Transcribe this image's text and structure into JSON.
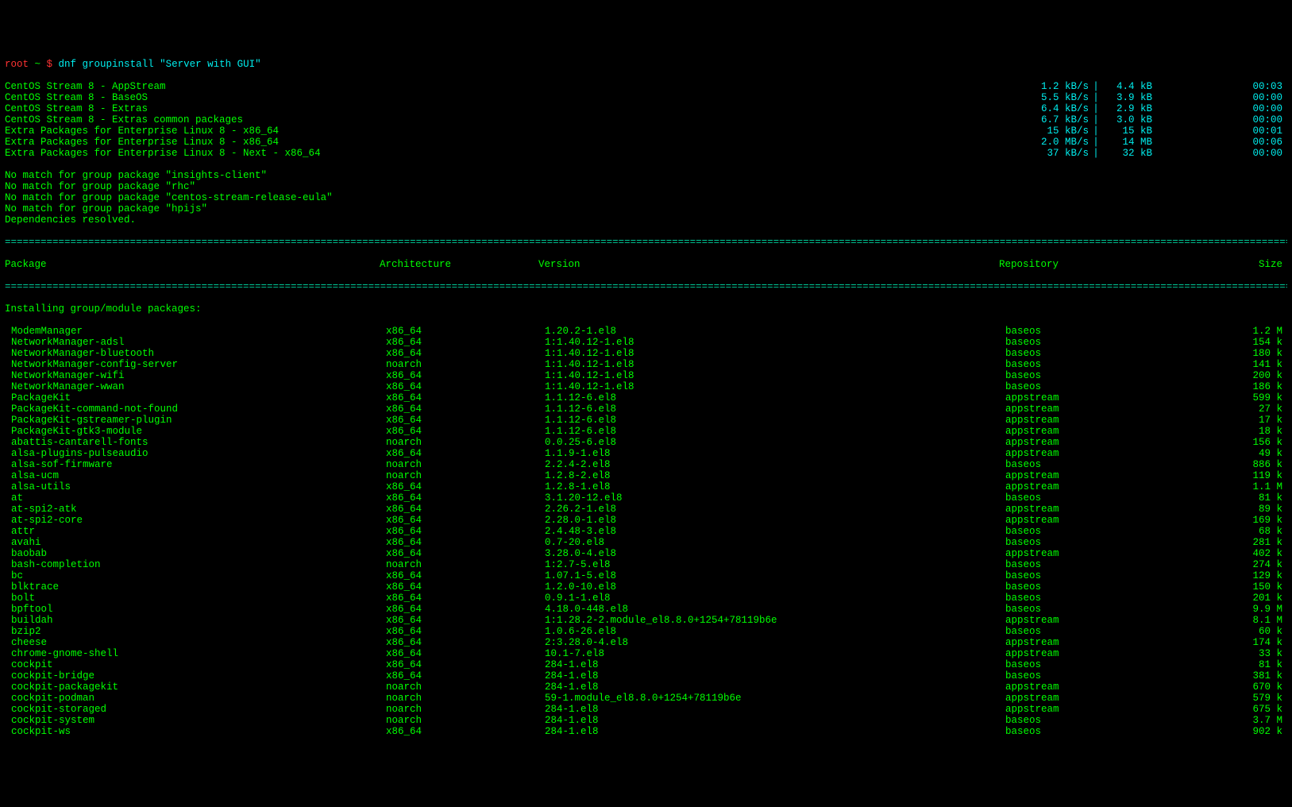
{
  "prompt": {
    "user": "root",
    "sep1": " ~ ",
    "sym": "$",
    "cmd": " dnf groupinstall \"Server with GUI\""
  },
  "repos": [
    {
      "name": "CentOS Stream 8 - AppStream",
      "speed": "1.2 kB/s",
      "size": "4.4 kB",
      "time": "00:03"
    },
    {
      "name": "CentOS Stream 8 - BaseOS",
      "speed": "5.5 kB/s",
      "size": "3.9 kB",
      "time": "00:00"
    },
    {
      "name": "CentOS Stream 8 - Extras",
      "speed": "6.4 kB/s",
      "size": "2.9 kB",
      "time": "00:00"
    },
    {
      "name": "CentOS Stream 8 - Extras common packages",
      "speed": "6.7 kB/s",
      "size": "3.0 kB",
      "time": "00:00"
    },
    {
      "name": "Extra Packages for Enterprise Linux 8 - x86_64",
      "speed": "15 kB/s",
      "size": "15 kB",
      "time": "00:01"
    },
    {
      "name": "Extra Packages for Enterprise Linux 8 - x86_64",
      "speed": "2.0 MB/s",
      "size": "14 MB",
      "time": "00:06"
    },
    {
      "name": "Extra Packages for Enterprise Linux 8 - Next - x86_64",
      "speed": "37 kB/s",
      "size": "32 kB",
      "time": "00:00"
    }
  ],
  "warnings": [
    "No match for group package \"insights-client\"",
    "No match for group package \"rhc\"",
    "No match for group package \"centos-stream-release-eula\"",
    "No match for group package \"hpijs\"",
    "Dependencies resolved."
  ],
  "headers": {
    "pkg": "Package",
    "arch": "Architecture",
    "ver": "Version",
    "repo": "Repository",
    "size": "Size"
  },
  "section_title": "Installing group/module packages:",
  "packages": [
    {
      "n": "ModemManager",
      "a": "x86_64",
      "v": "1.20.2-1.el8",
      "r": "baseos",
      "s": "1.2 M"
    },
    {
      "n": "NetworkManager-adsl",
      "a": "x86_64",
      "v": "1:1.40.12-1.el8",
      "r": "baseos",
      "s": "154 k"
    },
    {
      "n": "NetworkManager-bluetooth",
      "a": "x86_64",
      "v": "1:1.40.12-1.el8",
      "r": "baseos",
      "s": "180 k"
    },
    {
      "n": "NetworkManager-config-server",
      "a": "noarch",
      "v": "1:1.40.12-1.el8",
      "r": "baseos",
      "s": "141 k"
    },
    {
      "n": "NetworkManager-wifi",
      "a": "x86_64",
      "v": "1:1.40.12-1.el8",
      "r": "baseos",
      "s": "200 k"
    },
    {
      "n": "NetworkManager-wwan",
      "a": "x86_64",
      "v": "1:1.40.12-1.el8",
      "r": "baseos",
      "s": "186 k"
    },
    {
      "n": "PackageKit",
      "a": "x86_64",
      "v": "1.1.12-6.el8",
      "r": "appstream",
      "s": "599 k"
    },
    {
      "n": "PackageKit-command-not-found",
      "a": "x86_64",
      "v": "1.1.12-6.el8",
      "r": "appstream",
      "s": "27 k"
    },
    {
      "n": "PackageKit-gstreamer-plugin",
      "a": "x86_64",
      "v": "1.1.12-6.el8",
      "r": "appstream",
      "s": "17 k"
    },
    {
      "n": "PackageKit-gtk3-module",
      "a": "x86_64",
      "v": "1.1.12-6.el8",
      "r": "appstream",
      "s": "18 k"
    },
    {
      "n": "abattis-cantarell-fonts",
      "a": "noarch",
      "v": "0.0.25-6.el8",
      "r": "appstream",
      "s": "156 k"
    },
    {
      "n": "alsa-plugins-pulseaudio",
      "a": "x86_64",
      "v": "1.1.9-1.el8",
      "r": "appstream",
      "s": "49 k"
    },
    {
      "n": "alsa-sof-firmware",
      "a": "noarch",
      "v": "2.2.4-2.el8",
      "r": "baseos",
      "s": "886 k"
    },
    {
      "n": "alsa-ucm",
      "a": "noarch",
      "v": "1.2.8-2.el8",
      "r": "appstream",
      "s": "119 k"
    },
    {
      "n": "alsa-utils",
      "a": "x86_64",
      "v": "1.2.8-1.el8",
      "r": "appstream",
      "s": "1.1 M"
    },
    {
      "n": "at",
      "a": "x86_64",
      "v": "3.1.20-12.el8",
      "r": "baseos",
      "s": "81 k"
    },
    {
      "n": "at-spi2-atk",
      "a": "x86_64",
      "v": "2.26.2-1.el8",
      "r": "appstream",
      "s": "89 k"
    },
    {
      "n": "at-spi2-core",
      "a": "x86_64",
      "v": "2.28.0-1.el8",
      "r": "appstream",
      "s": "169 k"
    },
    {
      "n": "attr",
      "a": "x86_64",
      "v": "2.4.48-3.el8",
      "r": "baseos",
      "s": "68 k"
    },
    {
      "n": "avahi",
      "a": "x86_64",
      "v": "0.7-20.el8",
      "r": "baseos",
      "s": "281 k"
    },
    {
      "n": "baobab",
      "a": "x86_64",
      "v": "3.28.0-4.el8",
      "r": "appstream",
      "s": "402 k"
    },
    {
      "n": "bash-completion",
      "a": "noarch",
      "v": "1:2.7-5.el8",
      "r": "baseos",
      "s": "274 k"
    },
    {
      "n": "bc",
      "a": "x86_64",
      "v": "1.07.1-5.el8",
      "r": "baseos",
      "s": "129 k"
    },
    {
      "n": "blktrace",
      "a": "x86_64",
      "v": "1.2.0-10.el8",
      "r": "baseos",
      "s": "150 k"
    },
    {
      "n": "bolt",
      "a": "x86_64",
      "v": "0.9.1-1.el8",
      "r": "baseos",
      "s": "201 k"
    },
    {
      "n": "bpftool",
      "a": "x86_64",
      "v": "4.18.0-448.el8",
      "r": "baseos",
      "s": "9.9 M"
    },
    {
      "n": "buildah",
      "a": "x86_64",
      "v": "1:1.28.2-2.module_el8.8.0+1254+78119b6e",
      "r": "appstream",
      "s": "8.1 M"
    },
    {
      "n": "bzip2",
      "a": "x86_64",
      "v": "1.0.6-26.el8",
      "r": "baseos",
      "s": "60 k"
    },
    {
      "n": "cheese",
      "a": "x86_64",
      "v": "2:3.28.0-4.el8",
      "r": "appstream",
      "s": "174 k"
    },
    {
      "n": "chrome-gnome-shell",
      "a": "x86_64",
      "v": "10.1-7.el8",
      "r": "appstream",
      "s": "33 k"
    },
    {
      "n": "cockpit",
      "a": "x86_64",
      "v": "284-1.el8",
      "r": "baseos",
      "s": "81 k"
    },
    {
      "n": "cockpit-bridge",
      "a": "x86_64",
      "v": "284-1.el8",
      "r": "baseos",
      "s": "381 k"
    },
    {
      "n": "cockpit-packagekit",
      "a": "noarch",
      "v": "284-1.el8",
      "r": "appstream",
      "s": "670 k"
    },
    {
      "n": "cockpit-podman",
      "a": "noarch",
      "v": "59-1.module_el8.8.0+1254+78119b6e",
      "r": "appstream",
      "s": "579 k"
    },
    {
      "n": "cockpit-storaged",
      "a": "noarch",
      "v": "284-1.el8",
      "r": "appstream",
      "s": "675 k"
    },
    {
      "n": "cockpit-system",
      "a": "noarch",
      "v": "284-1.el8",
      "r": "baseos",
      "s": "3.7 M"
    },
    {
      "n": "cockpit-ws",
      "a": "x86_64",
      "v": "284-1.el8",
      "r": "baseos",
      "s": "902 k"
    }
  ],
  "rule": "=========================================================================================================================================================================================================================="
}
